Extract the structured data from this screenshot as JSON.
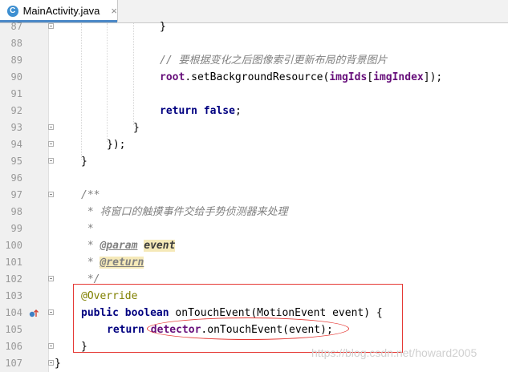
{
  "tab": {
    "icon_letter": "C",
    "filename": "MainActivity.java",
    "close": "×"
  },
  "lines": [
    {
      "n": "87"
    },
    {
      "n": "88"
    },
    {
      "n": "89"
    },
    {
      "n": "90"
    },
    {
      "n": "91"
    },
    {
      "n": "92"
    },
    {
      "n": "93"
    },
    {
      "n": "94"
    },
    {
      "n": "95"
    },
    {
      "n": "96"
    },
    {
      "n": "97"
    },
    {
      "n": "98"
    },
    {
      "n": "99"
    },
    {
      "n": "100"
    },
    {
      "n": "101"
    },
    {
      "n": "102"
    },
    {
      "n": "103"
    },
    {
      "n": "104"
    },
    {
      "n": "105"
    },
    {
      "n": "106"
    },
    {
      "n": "107"
    }
  ],
  "code": {
    "l87_brace": "}",
    "l89_comment": "// 要根据变化之后图像索引更新布局的背景图片",
    "l90_root": "root",
    "l90_call": ".setBackgroundResource(",
    "l90_imgIds": "imgIds",
    "l90_bracket": "[",
    "l90_imgIndex": "imgIndex",
    "l90_end": "]);",
    "l92_return": "return",
    "l92_false": "false",
    "l92_semi": ";",
    "l93": "}",
    "l94": "});",
    "l95": "}",
    "l97": "/**",
    "l98": " * 将窗口的触摸事件交给手势侦测器来处理",
    "l99": " *",
    "l100_star": " * ",
    "l100_tag": "@param",
    "l100_param": "event",
    "l101_star": " * ",
    "l101_tag": "@return",
    "l102": " */",
    "l103": "@Override",
    "l104_public": "public",
    "l104_boolean": "boolean",
    "l104_sig": "onTouchEvent(MotionEvent event) {",
    "l105_return": "return",
    "l105_detector": "detector",
    "l105_rest": ".onTouchEvent(event);",
    "l106": "}",
    "l107": "}"
  },
  "watermark": "https://blog.csdn.net/howard2005",
  "colors": {
    "annotation_box": "#e53935",
    "tab_accent": "#4a88c7",
    "keyword": "#000080",
    "field": "#660e7a"
  }
}
